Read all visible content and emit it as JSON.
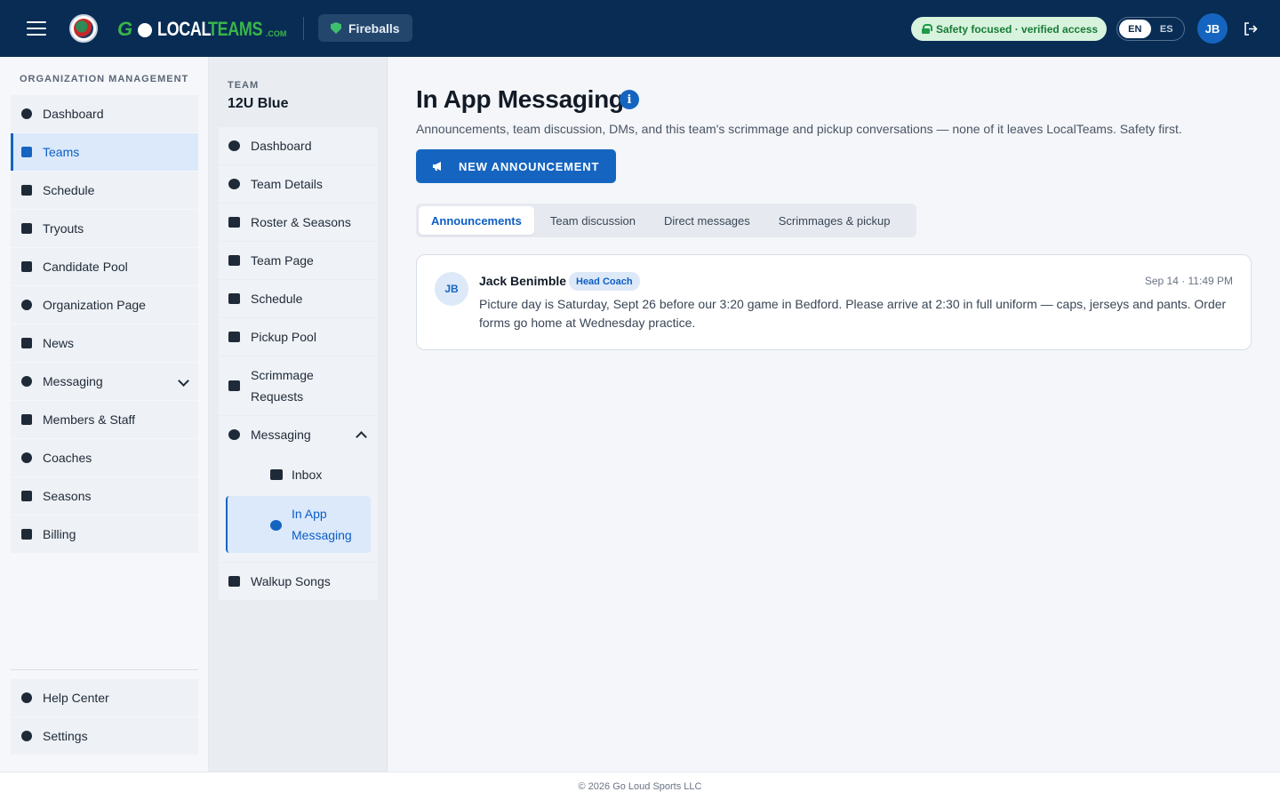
{
  "header": {
    "logo_text_local": "LOCAL",
    "logo_text_teams": "TEAMS",
    "logo_text_com": ".COM",
    "org_name": "Fireballs",
    "safety_text": "Safety focused · verified access",
    "lang_en": "EN",
    "lang_es": "ES",
    "avatar_initials": "JB",
    "colors": {
      "bar": "#082c54",
      "accent": "#1565c0",
      "safety": "#d8f3dd"
    }
  },
  "sidebar": {
    "heading": "ORGANIZATION MANAGEMENT",
    "items": [
      {
        "label": "Dashboard",
        "icon": "dashboard-icon"
      },
      {
        "label": "Teams",
        "icon": "teams-icon"
      },
      {
        "label": "Schedule",
        "icon": "calendar-icon"
      },
      {
        "label": "Tryouts",
        "icon": "clipboard-icon"
      },
      {
        "label": "Candidate Pool",
        "icon": "scan-users-icon"
      },
      {
        "label": "Organization Page",
        "icon": "globe-icon"
      },
      {
        "label": "News",
        "icon": "newspaper-icon"
      },
      {
        "label": "Messaging",
        "icon": "chat-icon"
      },
      {
        "label": "Members & Staff",
        "icon": "id-card-icon"
      },
      {
        "label": "Coaches",
        "icon": "coach-icon"
      },
      {
        "label": "Seasons",
        "icon": "calendar-grid-icon"
      },
      {
        "label": "Billing",
        "icon": "credit-card-icon"
      }
    ],
    "bottom": [
      {
        "label": "Help Center",
        "icon": "help-icon"
      },
      {
        "label": "Settings",
        "icon": "gear-icon"
      }
    ]
  },
  "subnav": {
    "team_label": "TEAM",
    "team_name": "12U Blue",
    "items": [
      {
        "label": "Dashboard",
        "icon": "dashboard-icon"
      },
      {
        "label": "Team Details",
        "icon": "info-icon"
      },
      {
        "label": "Roster & Seasons",
        "icon": "list-icon"
      },
      {
        "label": "Team Page",
        "icon": "edit-page-icon"
      },
      {
        "label": "Schedule",
        "icon": "calendar-icon"
      },
      {
        "label": "Pickup Pool",
        "icon": "inbox-tray-icon"
      },
      {
        "label": "Scrimmage Requests",
        "icon": "people-exchange-icon"
      }
    ],
    "messaging": {
      "label": "Messaging",
      "children": [
        {
          "label": "Inbox",
          "icon": "inbox-icon"
        },
        {
          "label": "In App Messaging",
          "icon": "chat-bubble-icon"
        }
      ]
    },
    "walkup": {
      "label": "Walkup Songs",
      "icon": "music-note-icon"
    }
  },
  "main": {
    "title": "In App Messaging",
    "info_glyph": "i",
    "description": "Announcements, team discussion, DMs, and this team's scrimmage and pickup conversations — none of it leaves LocalTeams. Safety first.",
    "new_button": "NEW ANNOUNCEMENT",
    "tabs": [
      {
        "label": "Announcements",
        "active": true
      },
      {
        "label": "Team discussion",
        "active": false
      },
      {
        "label": "Direct messages",
        "active": false
      },
      {
        "label": "Scrimmages & pickup",
        "active": false
      }
    ],
    "announcement": {
      "initials": "JB",
      "author": "Jack Benimble",
      "role": "Head Coach",
      "time": "Sep 14 · 11:49 PM",
      "body": "Picture day is Saturday, Sept 26 before our 3:20 game in Bedford. Please arrive at 2:30 in full uniform — caps, jerseys and pants. Order forms go home at Wednesday practice."
    }
  },
  "footer": {
    "text": "© 2026 Go Loud Sports LLC"
  }
}
